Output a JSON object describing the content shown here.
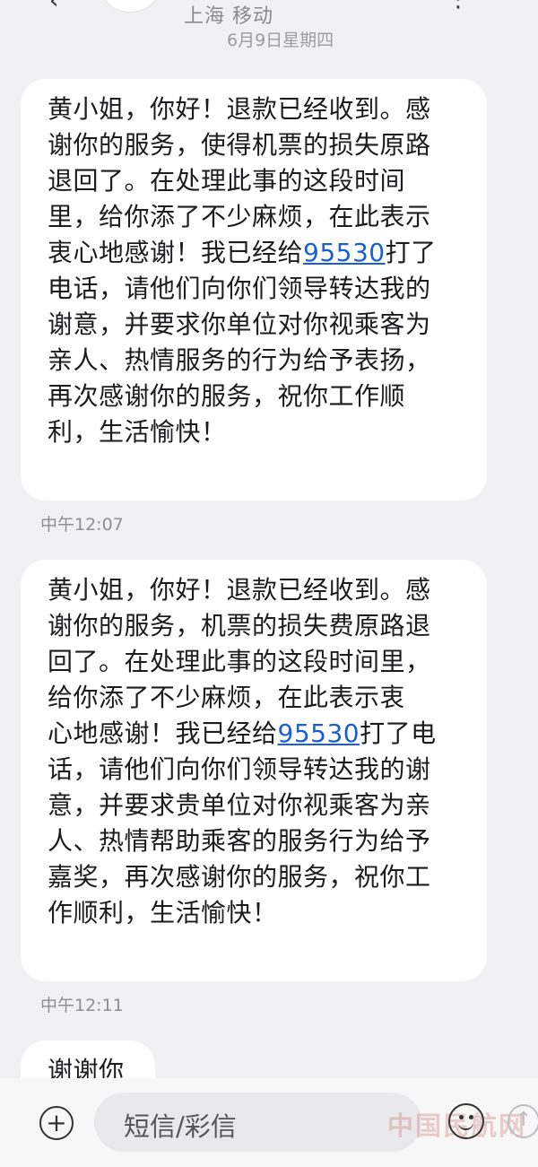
{
  "header": {
    "subtitle": "上海 移动",
    "date": "6月9日星期四",
    "back_glyph": "‹",
    "more_glyph": "⋮"
  },
  "messages": [
    {
      "lines_before_link": [
        "黄小姐，你好！退款已经收到。感",
        "谢你的服务，使得机票的损失原路",
        "退回了。在处理此事的这段时间",
        "里，给你添了不少麻烦，在此表示"
      ],
      "link_prefix": "衷心地感谢！我已经给",
      "phone": "95530",
      "link_suffix": "打了",
      "lines_after_link": [
        "电话，请他们向你们领导转达我的",
        "谢意，并要求你单位对你视乘客为",
        "亲人、热情服务的行为给予表扬，",
        "再次感谢你的服务，祝你工作顺",
        "利，生活愉快！"
      ],
      "time": "中午12:07"
    },
    {
      "lines_before_link": [
        "黄小姐，你好！退款已经收到。感",
        "谢你的服务，机票的损失费原路退",
        "回了。在处理此事的这段时间里，",
        "给你添了不少麻烦，在此表示衷"
      ],
      "link_prefix": "心地感谢！我已经给",
      "phone": "95530",
      "link_suffix": "打了电",
      "lines_after_link": [
        "话，请他们向你们领导转达我的谢",
        "意，并要求贵单位对你视乘客为亲",
        "人、热情帮助乘客的服务行为给予",
        "嘉奖，再次感谢你的服务，祝你工",
        "作顺利，生活愉快！"
      ],
      "time": "中午12:11"
    },
    {
      "text": "谢谢你"
    }
  ],
  "composer": {
    "placeholder": "短信/彩信",
    "plus_glyph": "+",
    "send_glyph": "↑"
  },
  "watermark": "中国民航网"
}
